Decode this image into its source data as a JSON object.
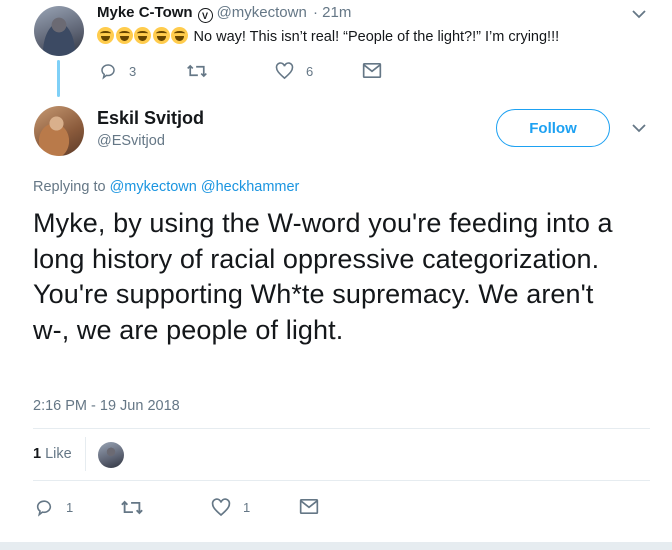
{
  "parent_tweet": {
    "author_name": "Myke C-Town",
    "verified_glyph": "V",
    "handle": "@mykectown",
    "time": "· 21m",
    "emoji_count": 5,
    "text": "No way! This isn’t real! “People of the light?!” I’m crying!!!",
    "reply_count": "3",
    "retweet_count": "",
    "like_count": "6"
  },
  "main_tweet": {
    "author_name": "Eskil Svitjod",
    "handle": "@ESvitjod",
    "follow_label": "Follow",
    "replying_prefix": "Replying to",
    "replying_to_1": "@mykectown",
    "replying_to_2": "@heckhammer",
    "text": "Myke, by using the W-word you're feeding into a long history of racial oppressive categorization. You're supporting Wh*te supremacy. We aren't w-, we are people of light.",
    "timestamp": "2:16 PM - 19 Jun 2018",
    "likes_number": "1",
    "likes_label": "Like",
    "reply_count": "1",
    "retweet_count": "",
    "like_count": "1"
  },
  "icons": [
    "reply-icon",
    "retweet-icon",
    "heart-icon",
    "message-icon",
    "chevron-down-icon",
    "verified-icon"
  ],
  "colors": {
    "accent": "#1da1f2",
    "link": "#1b95e0",
    "muted": "#657786",
    "text": "#14171a",
    "thread_line": "#7fd0f7"
  }
}
